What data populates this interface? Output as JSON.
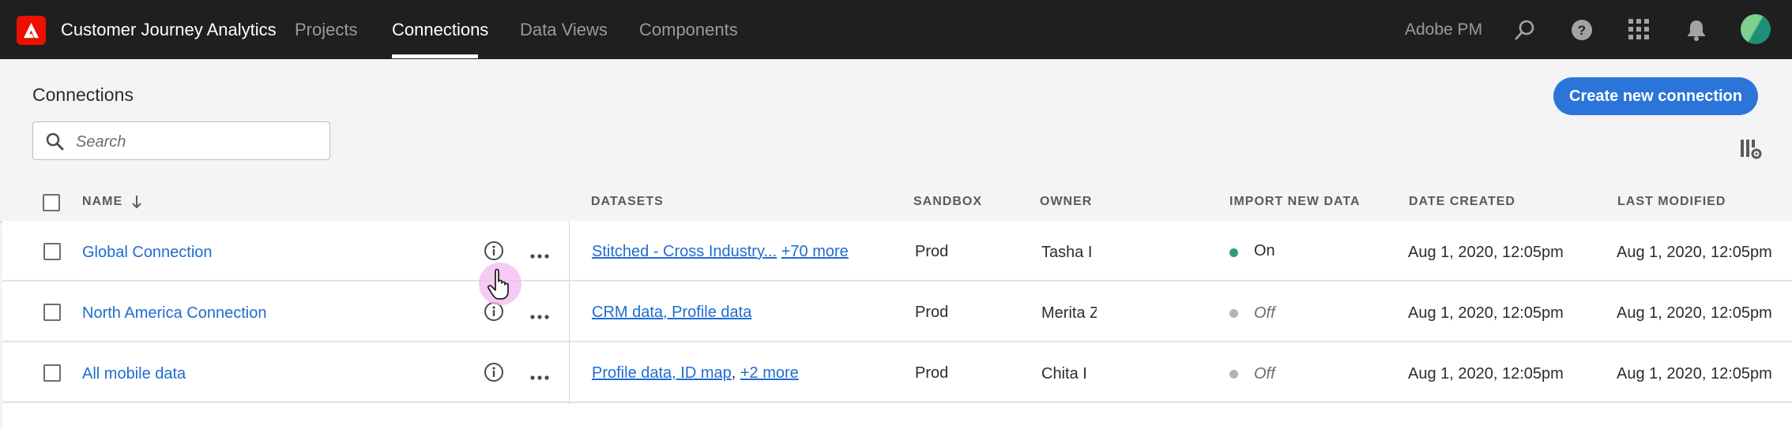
{
  "topbar": {
    "app_title": "Customer Journey Analytics",
    "tabs": [
      {
        "label": "Projects",
        "active": false
      },
      {
        "label": "Connections",
        "active": true
      },
      {
        "label": "Data Views",
        "active": false
      },
      {
        "label": "Components",
        "active": false
      }
    ],
    "org_name": "Adobe PM",
    "icons": [
      "search-icon",
      "help-icon",
      "app-switcher-icon",
      "notifications-bell-icon"
    ]
  },
  "page": {
    "title": "Connections",
    "create_button_label": "Create new connection",
    "search_placeholder": "Search"
  },
  "table": {
    "columns": {
      "name": "NAME",
      "datasets": "DATASETS",
      "sandbox": "SANDBOX",
      "owner": "OWNER",
      "import_new_data": "IMPORT NEW DATA",
      "date_created": "DATE CREATED",
      "last_modified": "LAST MODIFIED"
    },
    "sort": {
      "column": "name",
      "direction": "descending"
    },
    "rows": [
      {
        "name": "Global Connection",
        "datasets": "Stitched - Cross Industry...",
        "datasets_more": "+70 more",
        "sandbox": "Prod",
        "owner": "Tasha I",
        "import_status": "On",
        "date_created": "Aug 1, 2020, 12:05pm",
        "last_modified": "Aug 1, 2020, 12:05pm"
      },
      {
        "name": "North America Connection",
        "datasets": "CRM data, Profile data",
        "datasets_more": "",
        "sandbox": "Prod",
        "owner": "Merita Z",
        "import_status": "Off",
        "date_created": "Aug 1, 2020, 12:05pm",
        "last_modified": "Aug 1, 2020, 12:05pm"
      },
      {
        "name": "All mobile data",
        "datasets": "Profile data, ID map",
        "datasets_more": "+2 more",
        "sandbox": "Prod",
        "owner": "Chita I",
        "import_status": "Off",
        "date_created": "Aug 1, 2020, 12:05pm",
        "last_modified": "Aug 1, 2020, 12:05pm"
      }
    ]
  },
  "colors": {
    "topbar_bg": "#1f1f1f",
    "accent_blue": "#2b74d9",
    "link_blue": "#1f6cd1",
    "status_on": "#2d9d78",
    "status_off": "#b3b3b3",
    "adobe_red": "#eb1000"
  }
}
